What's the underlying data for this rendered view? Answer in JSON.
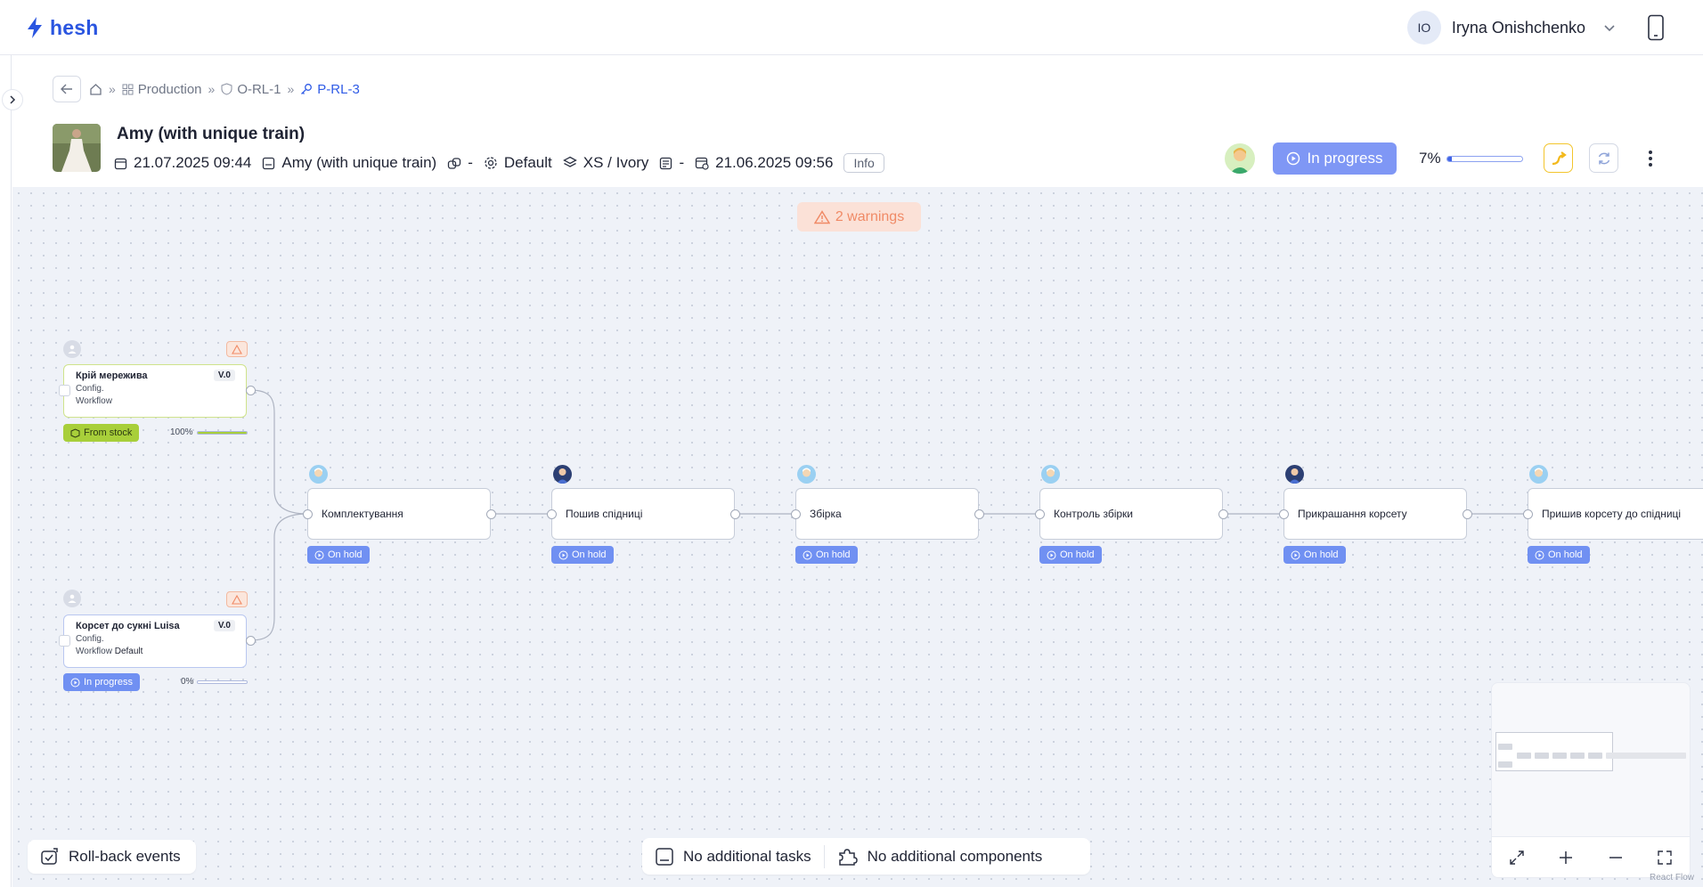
{
  "app": {
    "logo_text": "hesh",
    "logo_icon": "bolt-icon"
  },
  "user": {
    "initials": "IO",
    "name": "Iryna Onishchenko"
  },
  "breadcrumb": {
    "items": [
      "Production",
      "O-RL-1",
      "P-RL-3"
    ]
  },
  "product": {
    "title": "Amy (with unique train)",
    "created": "21.07.2025 09:44",
    "model": "Amy (with unique train)",
    "link": "-",
    "config": "Default",
    "size_color": "XS / Ivory",
    "doc": "-",
    "due": "21.06.2025 09:56",
    "info_label": "Info"
  },
  "status": {
    "label": "In progress",
    "progress_label": "7%",
    "progress": 0.07
  },
  "canvas": {
    "warnings": "2 warnings",
    "sources": [
      {
        "title": "Крій мережива",
        "version": "V.0",
        "line1": "Config.",
        "line2_label": "Workflow",
        "line2_value": "",
        "chip": "From stock",
        "pct": "100%",
        "progress": 1.0
      },
      {
        "title": "Корсет до сукні Luisa",
        "version": "V.0",
        "line1": "Config.",
        "line2_label": "Workflow",
        "line2_value": "Default",
        "chip": "In progress",
        "pct": "0%",
        "progress": 0.0
      }
    ],
    "steps": [
      {
        "label": "Комплектування",
        "status": "On hold"
      },
      {
        "label": "Пошив спідниці",
        "status": "On hold"
      },
      {
        "label": "Збірка",
        "status": "On hold"
      },
      {
        "label": "Контроль збірки",
        "status": "On hold"
      },
      {
        "label": "Прикрашання корсету",
        "status": "On hold"
      },
      {
        "label": "Пришив корсету до спідниці",
        "status": "On hold"
      }
    ]
  },
  "footer": {
    "rollback": "Roll-back events",
    "no_tasks": "No additional tasks",
    "no_components": "No additional components",
    "attribution": "React Flow"
  },
  "colors": {
    "accent": "#2f5be6",
    "status_blue": "#7f97f5",
    "warning": "#f08a66",
    "stock": "#a8cf3a"
  }
}
